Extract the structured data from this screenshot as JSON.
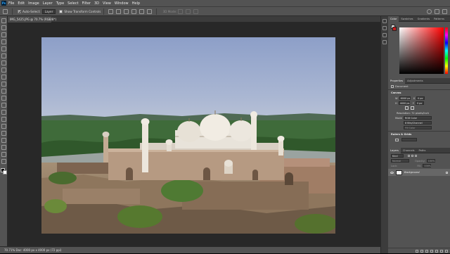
{
  "menubar": {
    "logo": "Ps",
    "items": [
      "File",
      "Edit",
      "Image",
      "Layer",
      "Type",
      "Select",
      "Filter",
      "3D",
      "View",
      "Window",
      "Help"
    ]
  },
  "options": {
    "auto_select_label": "Auto-Select:",
    "auto_select_mode": "Layer",
    "transform_label": "Show Transform Controls",
    "mode_label": "3D Mode:"
  },
  "document": {
    "tab_title": "IMG_5425.JPG @ 70.7% (RGB/8*)",
    "tab_close": "×"
  },
  "statusbar": {
    "text": "70.71%     Doc: 4000 px x 4000 px (72 ppi)"
  },
  "colors": {
    "accent_fg": "#e8e8e8",
    "accent_bg": "#c41e1e",
    "panel": "#535353",
    "canvas_bg": "#282828"
  },
  "color_panel": {
    "tabs": [
      "Color",
      "Swatches",
      "Gradients",
      "Patterns"
    ]
  },
  "properties_panel": {
    "tabs": [
      "Properties",
      "Adjustments"
    ],
    "document_label": "Document",
    "canvas_heading": "Canvas",
    "w_label": "W",
    "w_value": "6000 px",
    "h_label": "H",
    "h_value": "4000 px",
    "x_label": "X",
    "x_value": "0 px",
    "y_label": "Y",
    "y_value": "0 px",
    "resolution": "Resolution: 72 pixels/Inch",
    "mode_label": "Mode",
    "mode_value": "RGB Color",
    "depth_value": "8 Bits/Channel",
    "fill_value": "Fill Color",
    "rulers_heading": "Rulers & Grids"
  },
  "layers_panel": {
    "tabs": [
      "Layers",
      "Channels",
      "Paths"
    ],
    "kind_label": "Kind",
    "blend_mode": "Normal",
    "opacity_label": "Opacity:",
    "opacity_value": "100%",
    "lock_label": "Lock:",
    "fill_label": "Fill:",
    "fill_value": "100%",
    "layer_name": "Background"
  }
}
